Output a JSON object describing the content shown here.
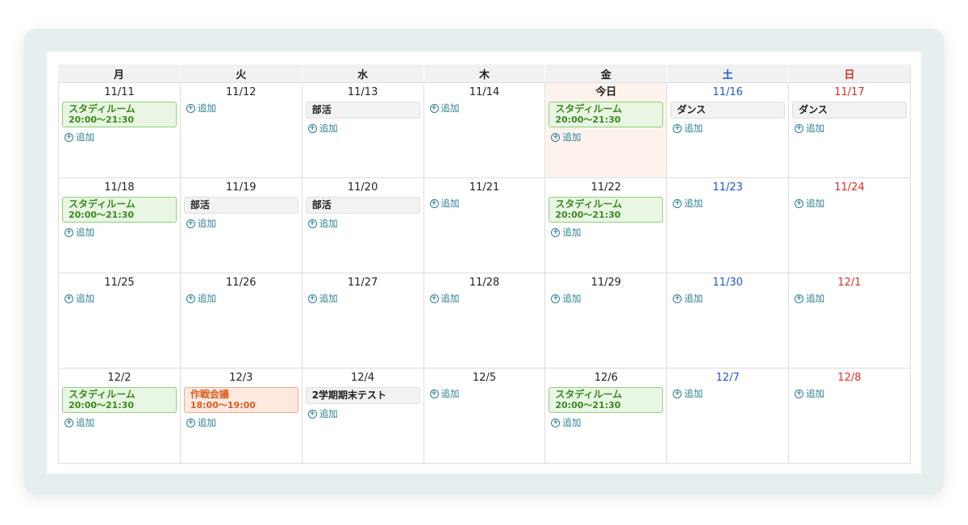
{
  "weekdays": [
    {
      "label": "月",
      "kind": "weekday"
    },
    {
      "label": "火",
      "kind": "weekday"
    },
    {
      "label": "水",
      "kind": "weekday"
    },
    {
      "label": "木",
      "kind": "weekday"
    },
    {
      "label": "金",
      "kind": "weekday"
    },
    {
      "label": "土",
      "kind": "sat"
    },
    {
      "label": "日",
      "kind": "sun"
    }
  ],
  "add_label": "追加",
  "add_icon": "plus-circle-icon",
  "colors": {
    "saturday": "#1e56c4",
    "sunday": "#d93025",
    "today_bg": "#fdf3ec",
    "add_link": "#2a7f93"
  },
  "weeks": [
    [
      {
        "date": "11/11",
        "events": [
          {
            "title": "スタディルーム",
            "time": "20:00〜21:30",
            "color": "green"
          }
        ]
      },
      {
        "date": "11/12",
        "events": []
      },
      {
        "date": "11/13",
        "events": [
          {
            "title": "部活",
            "color": "gray"
          }
        ]
      },
      {
        "date": "11/14",
        "events": []
      },
      {
        "date": "今日",
        "today": true,
        "events": [
          {
            "title": "スタディルーム",
            "time": "20:00〜21:30",
            "color": "green"
          }
        ]
      },
      {
        "date": "11/16",
        "events": [
          {
            "title": "ダンス",
            "color": "gray"
          }
        ]
      },
      {
        "date": "11/17",
        "events": [
          {
            "title": "ダンス",
            "color": "gray"
          }
        ]
      }
    ],
    [
      {
        "date": "11/18",
        "events": [
          {
            "title": "スタディルーム",
            "time": "20:00〜21:30",
            "color": "green"
          }
        ]
      },
      {
        "date": "11/19",
        "events": [
          {
            "title": "部活",
            "color": "gray"
          }
        ]
      },
      {
        "date": "11/20",
        "events": [
          {
            "title": "部活",
            "color": "gray"
          }
        ]
      },
      {
        "date": "11/21",
        "events": []
      },
      {
        "date": "11/22",
        "events": [
          {
            "title": "スタディルーム",
            "time": "20:00〜21:30",
            "color": "green"
          }
        ]
      },
      {
        "date": "11/23",
        "events": []
      },
      {
        "date": "11/24",
        "events": []
      }
    ],
    [
      {
        "date": "11/25",
        "events": []
      },
      {
        "date": "11/26",
        "events": []
      },
      {
        "date": "11/27",
        "events": []
      },
      {
        "date": "11/28",
        "events": []
      },
      {
        "date": "11/29",
        "events": []
      },
      {
        "date": "11/30",
        "events": []
      },
      {
        "date": "12/1",
        "events": []
      }
    ],
    [
      {
        "date": "12/2",
        "events": [
          {
            "title": "スタディルーム",
            "time": "20:00〜21:30",
            "color": "green"
          }
        ]
      },
      {
        "date": "12/3",
        "events": [
          {
            "title": "作戦会議",
            "time": "18:00〜19:00",
            "color": "orange"
          }
        ]
      },
      {
        "date": "12/4",
        "events": [
          {
            "title": "2学期期末テスト",
            "color": "gray"
          }
        ]
      },
      {
        "date": "12/5",
        "events": []
      },
      {
        "date": "12/6",
        "events": [
          {
            "title": "スタディルーム",
            "time": "20:00〜21:30",
            "color": "green"
          }
        ]
      },
      {
        "date": "12/7",
        "events": []
      },
      {
        "date": "12/8",
        "events": []
      }
    ]
  ]
}
